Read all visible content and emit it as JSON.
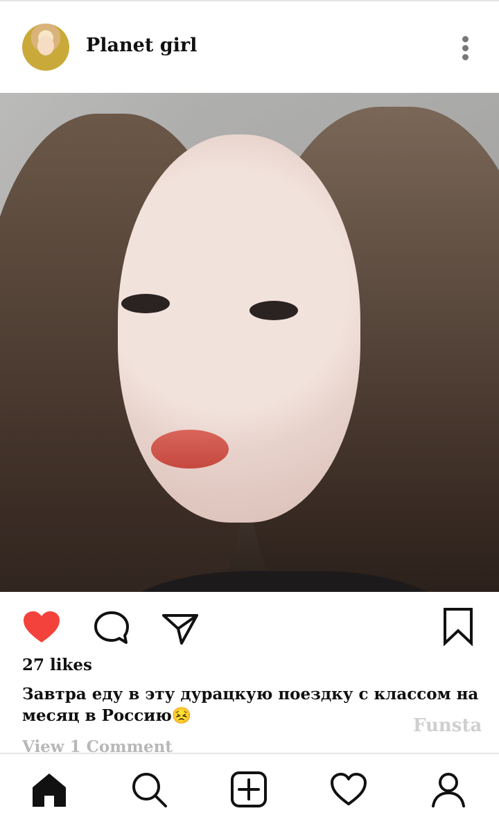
{
  "post": {
    "username": "Planet girl",
    "likes": "27 likes",
    "caption": "Завтра еду в эту дурацкую поездку с классом на месяц в Россию😣",
    "view_comments": "View 1 Comment",
    "watermark": "Funsta"
  },
  "colors": {
    "like_active": "#f3423c",
    "icon": "#111111",
    "muted": "#b8b8b8"
  },
  "icons": {
    "menu": "three-dots-vertical",
    "like": "heart-filled",
    "comment": "speech-bubble",
    "share": "paper-plane",
    "save": "bookmark",
    "nav_home": "home",
    "nav_search": "search",
    "nav_add": "plus-square",
    "nav_activity": "heart",
    "nav_profile": "user"
  }
}
